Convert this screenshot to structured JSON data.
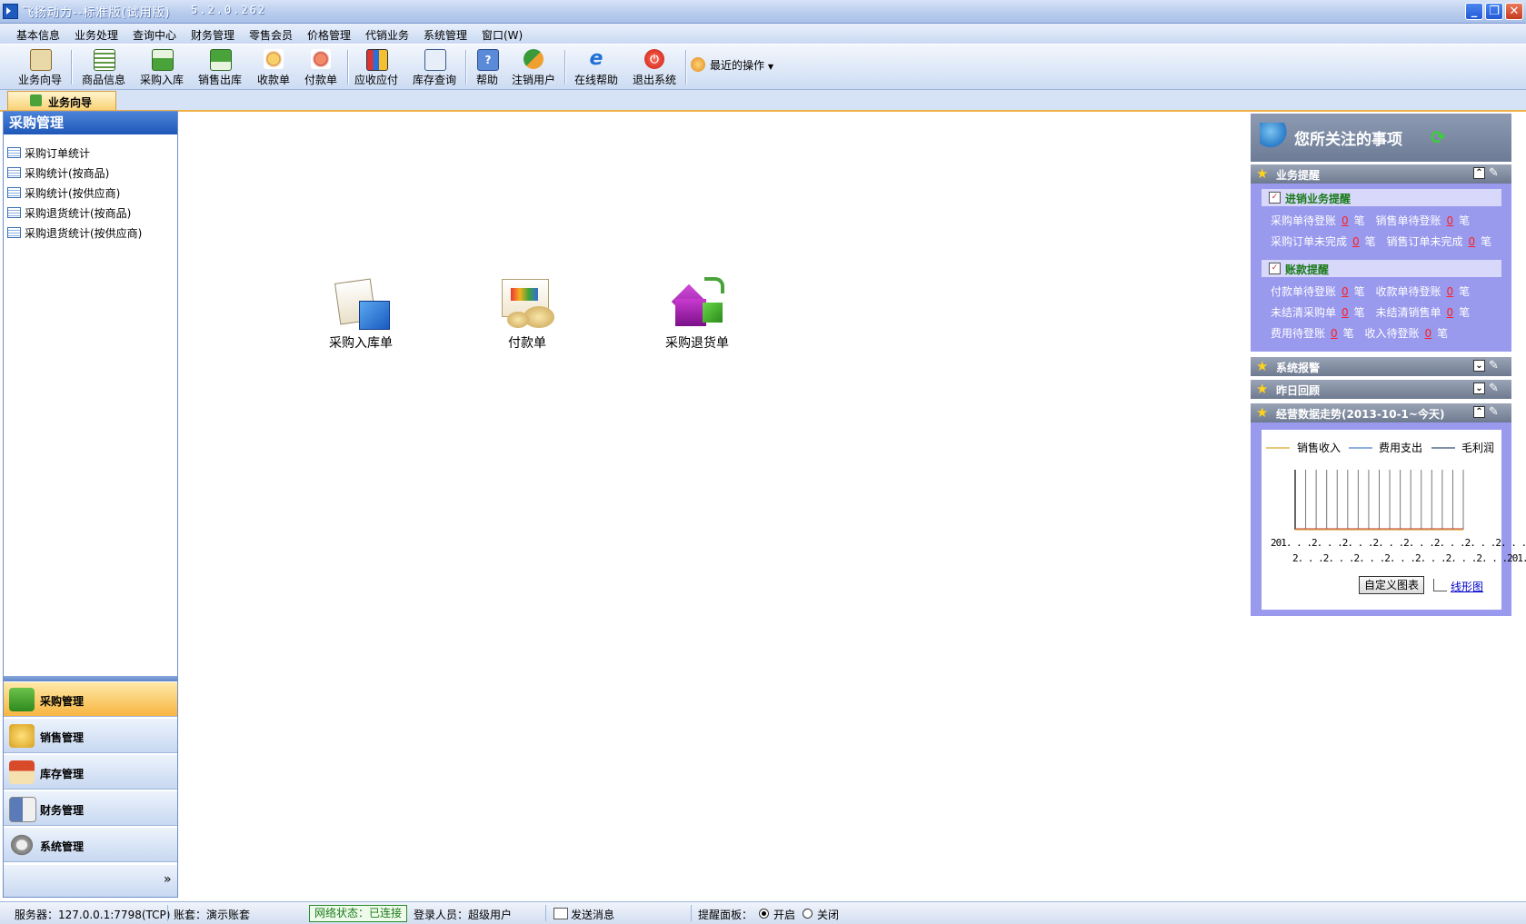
{
  "window": {
    "title": "飞扬动力--标准版(试用版)",
    "version": "5.2.0.262"
  },
  "menu": [
    "基本信息",
    "业务处理",
    "查询中心",
    "财务管理",
    "零售会员",
    "价格管理",
    "代销业务",
    "系统管理",
    "窗口(W)"
  ],
  "toolbar": {
    "items": [
      "业务向导",
      "商品信息",
      "采购入库",
      "销售出库",
      "收款单",
      "付款单",
      "应收应付",
      "库存查询",
      "帮助",
      "注销用户",
      "在线帮助",
      "退出系统"
    ],
    "recent": "最近的操作"
  },
  "tab": {
    "label": "业务向导"
  },
  "left_panel": {
    "title": "采购管理",
    "items": [
      "采购订单统计",
      "采购统计(按商品)",
      "采购统计(按供应商)",
      "采购退货统计(按商品)",
      "采购退货统计(按供应商)"
    ],
    "nav": [
      "采购管理",
      "销售管理",
      "库存管理",
      "财务管理",
      "系统管理"
    ],
    "more": "»"
  },
  "center": {
    "icons": [
      "采购入库单",
      "付款单",
      "采购退货单"
    ]
  },
  "right_panel": {
    "header": "您所关注的事项",
    "section_business": "业务提醒",
    "sub_trade": "进销业务提醒",
    "line1": {
      "a": "采购单待登账",
      "a_val": "0",
      "b": "销售单待登账",
      "b_val": "0",
      "unit": "笔"
    },
    "line2": {
      "a": "采购订单未完成",
      "a_val": "0",
      "b": "销售订单未完成",
      "b_val": "0",
      "unit": "笔"
    },
    "sub_account": "账款提醒",
    "line3": {
      "a": "付款单待登账",
      "a_val": "0",
      "b": "收款单待登账",
      "b_val": "0",
      "unit": "笔"
    },
    "line4": {
      "a": "未结清采购单",
      "a_val": "0",
      "b": "未结清销售单",
      "b_val": "0",
      "unit": "笔"
    },
    "line5": {
      "a": "费用待登账",
      "a_val": "0",
      "b": "收入待登账",
      "b_val": "0",
      "unit": "笔"
    },
    "section_alarm": "系统报警",
    "section_review": "昨日回顾",
    "section_trend": "经营数据走势(2013-10-1~今天)",
    "legend": [
      "销售收入",
      "费用支出",
      "毛利润"
    ],
    "x_row1": "201. . .2. . .2. . .2. . .2. . .2. . .2. . .2. . .",
    "x_row2": "2. . .2. . .2. . .2. . .2. . .2. . .2. . .201. . .",
    "btn_custom": "自定义图表",
    "link_line": "线形图",
    "colors": {
      "sales": "#e8c878",
      "expense": "#8fb0e0",
      "profit": "#8090a8"
    }
  },
  "status": {
    "server": "服务器：127.0.0.1:7798(TCP)",
    "account": "账套：演示账套",
    "network": "网络状态：已连接",
    "user": "登录人员：超级用户",
    "send": "发送消息",
    "remind": "提醒面板：",
    "on": "开启",
    "off": "关闭"
  }
}
